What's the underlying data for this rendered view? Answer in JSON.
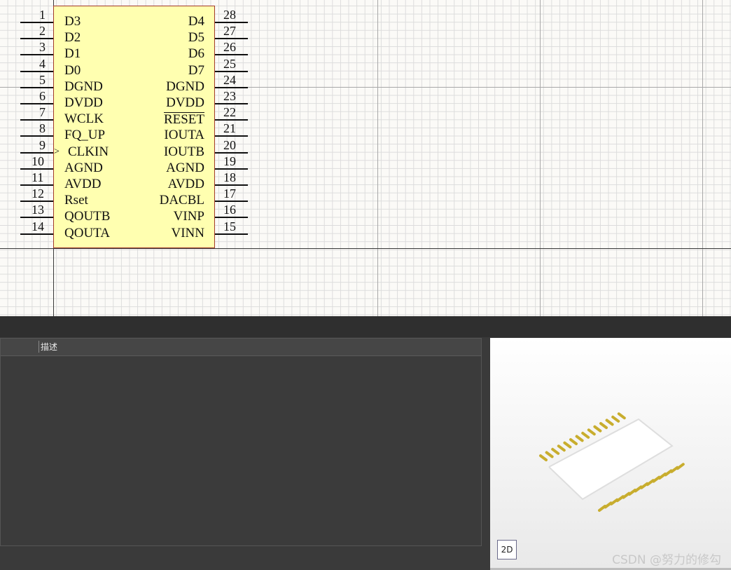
{
  "schematic": {
    "left_pins": [
      {
        "num": "1",
        "name": "D3"
      },
      {
        "num": "2",
        "name": "D2"
      },
      {
        "num": "3",
        "name": "D1"
      },
      {
        "num": "4",
        "name": "D0"
      },
      {
        "num": "5",
        "name": "DGND"
      },
      {
        "num": "6",
        "name": "DVDD"
      },
      {
        "num": "7",
        "name": "WCLK"
      },
      {
        "num": "8",
        "name": "FQ_UP"
      },
      {
        "num": "9",
        "name": "CLKIN",
        "clock": true
      },
      {
        "num": "10",
        "name": "AGND"
      },
      {
        "num": "11",
        "name": "AVDD"
      },
      {
        "num": "12",
        "name": "Rset"
      },
      {
        "num": "13",
        "name": "QOUTB"
      },
      {
        "num": "14",
        "name": "QOUTA"
      }
    ],
    "right_pins": [
      {
        "num": "28",
        "name": "D4"
      },
      {
        "num": "27",
        "name": "D5"
      },
      {
        "num": "26",
        "name": "D6"
      },
      {
        "num": "25",
        "name": "D7"
      },
      {
        "num": "24",
        "name": "DGND"
      },
      {
        "num": "23",
        "name": "DVDD"
      },
      {
        "num": "22",
        "name": "RESET",
        "overbar": true
      },
      {
        "num": "21",
        "name": "IOUTA"
      },
      {
        "num": "20",
        "name": "IOUTB"
      },
      {
        "num": "19",
        "name": "AGND"
      },
      {
        "num": "18",
        "name": "AVDD"
      },
      {
        "num": "17",
        "name": "DACBL"
      },
      {
        "num": "16",
        "name": "VINP"
      },
      {
        "num": "15",
        "name": "VINN"
      }
    ],
    "colors": {
      "body_fill": "#ffffb0",
      "body_border": "#a23a2a",
      "pad_gold": "#c8ad2e"
    }
  },
  "properties_panel": {
    "description_header": "描述"
  },
  "preview": {
    "view_toggle_label": "2D",
    "watermark": "CSDN @努力的修勾"
  }
}
